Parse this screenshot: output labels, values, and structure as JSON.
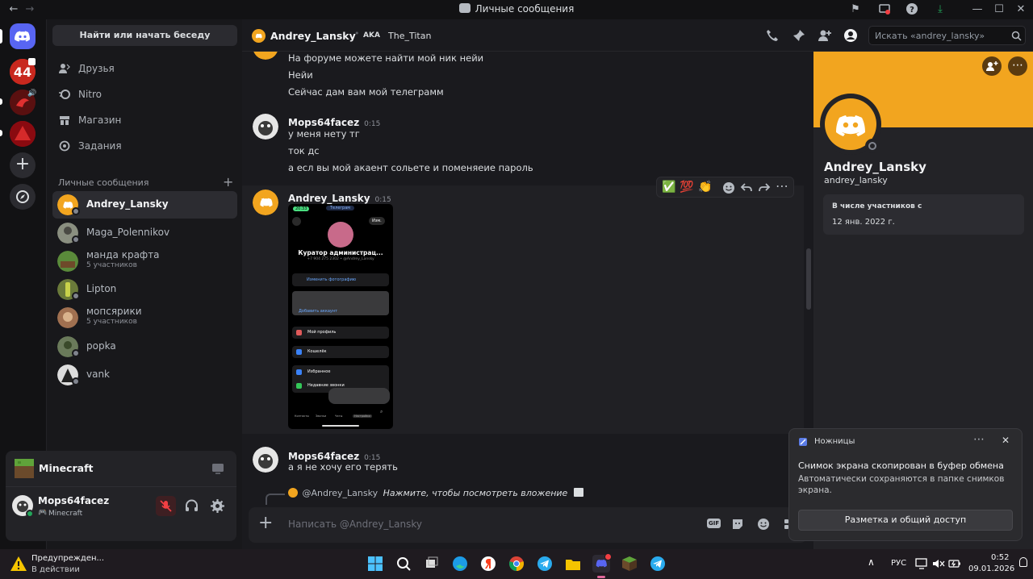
{
  "window": {
    "title": "Личные сообщения"
  },
  "sidebar": {
    "search_label": "Найти или начать беседу",
    "nav": [
      {
        "label": "Друзья"
      },
      {
        "label": "Nitro"
      },
      {
        "label": "Магазин"
      },
      {
        "label": "Задания"
      }
    ],
    "dm_header": "Личные сообщения",
    "dm_add": "+",
    "dms": [
      {
        "name": "Andrey_Lansky",
        "sub": ""
      },
      {
        "name": "Maga_Polennikov",
        "sub": ""
      },
      {
        "name": "манда крафта",
        "sub": "5 участников"
      },
      {
        "name": "Lipton",
        "sub": ""
      },
      {
        "name": "мопсярики",
        "sub": "5 участников"
      },
      {
        "name": "popka",
        "sub": ""
      },
      {
        "name": "vank",
        "sub": ""
      }
    ]
  },
  "activity": {
    "game": "Minecraft"
  },
  "user": {
    "name": "Mops64facez",
    "status": "Minecraft"
  },
  "chat": {
    "header_name": "Andrey_Lansky",
    "aka_label": "AKA",
    "aka_name": "The_Titan",
    "search_placeholder": "Искать «andrey_lansky»",
    "top_lines": [
      "На форуме можете найти мой ник нейи",
      "Нейи",
      "Сейчас дам вам мой телеграмм"
    ],
    "messages": [
      {
        "author": "Mops64facez",
        "time": "0:15",
        "lines": [
          "у меня нету тг",
          "ток дс",
          "а есл вы мой акаент сольете и поменяеие пароль"
        ]
      },
      {
        "author": "Andrey_Lansky",
        "time": "0:15",
        "lines": []
      },
      {
        "author": "Mops64facez",
        "time": "0:15",
        "lines": [
          "а я не хочу его терять"
        ]
      }
    ],
    "reactions": [
      "✅",
      "💯",
      "👏"
    ],
    "reply_mention": "@Andrey_Lansky",
    "reply_text": "Нажмите, чтобы посмотреть вложение",
    "input_placeholder": "Написать @Andrey_Lansky",
    "gif_label": "GIF",
    "attachment": {
      "status_time": "20:33",
      "top_pill": "Телеграм",
      "edit_label": "Изм.",
      "profile_name": "Куратор администрац...",
      "phone": "+7 904 275 2302 • @Andrey_Lansky",
      "change_photo": "Изменить фотографию",
      "add_account": "Добавить аккаунт",
      "menu": [
        "Мой профиль",
        "Кошелёк",
        "Избранное",
        "Недавние звонки"
      ],
      "tabs": [
        "Контакты",
        "Звонки",
        "Чаты",
        "Настройки"
      ]
    }
  },
  "profile": {
    "display_name": "Andrey_Lansky",
    "username": "andrey_lansky",
    "member_since_label": "В числе участников с",
    "member_since": "12 янв. 2022 г."
  },
  "toast": {
    "app": "Ножницы",
    "title": "Снимок экрана скопирован в буфер обмена",
    "body": "Автоматически сохраняются в папке снимков экрана.",
    "button": "Разметка и общий доступ"
  },
  "taskbar": {
    "weather_title": "Предупрежден...",
    "weather_sub": "В действии",
    "lang": "РУС",
    "time": "0:52",
    "date": "09.01.2026"
  },
  "colors": {
    "accent": "#5865f2",
    "banner": "#f2a51f",
    "mention": "#f2a51f"
  }
}
